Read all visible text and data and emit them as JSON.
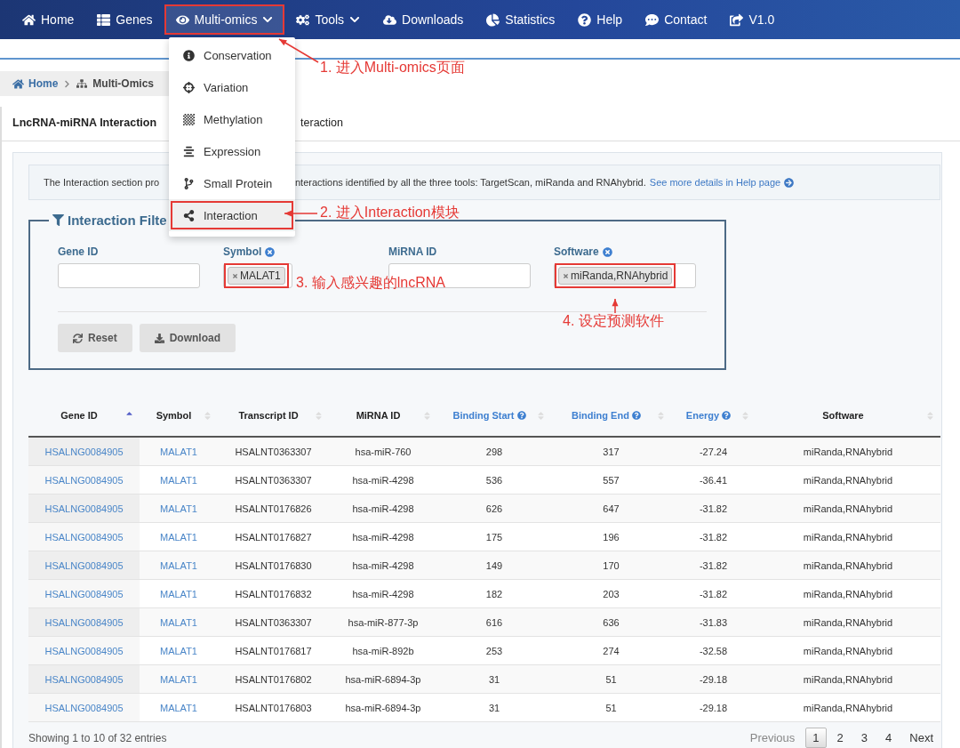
{
  "nav": {
    "items": [
      {
        "label": "Home",
        "selected": false,
        "caret": false,
        "marked": false
      },
      {
        "label": "Genes",
        "selected": false,
        "caret": false,
        "marked": false
      },
      {
        "label": "Multi-omics",
        "selected": true,
        "caret": true,
        "marked": true
      },
      {
        "label": "Tools",
        "selected": false,
        "caret": true,
        "marked": false
      },
      {
        "label": "Downloads",
        "selected": false,
        "caret": false,
        "marked": false
      },
      {
        "label": "Statistics",
        "selected": false,
        "caret": false,
        "marked": false
      },
      {
        "label": "Help",
        "selected": false,
        "caret": false,
        "marked": false
      },
      {
        "label": "Contact",
        "selected": false,
        "caret": false,
        "marked": false
      },
      {
        "label": "V1.0",
        "selected": false,
        "caret": false,
        "marked": false
      }
    ]
  },
  "dropdown": {
    "items": [
      {
        "label": "Conservation",
        "selected": false,
        "marked": false
      },
      {
        "label": "Variation",
        "selected": false,
        "marked": false
      },
      {
        "label": "Methylation",
        "selected": false,
        "marked": false
      },
      {
        "label": "Expression",
        "selected": false,
        "marked": false
      },
      {
        "label": "Small Protein",
        "selected": false,
        "marked": false
      },
      {
        "label": "Interaction",
        "selected": true,
        "marked": true
      }
    ]
  },
  "breadcrumb": [
    {
      "label": "Home"
    },
    {
      "label": "Multi-Omics"
    }
  ],
  "tabs": [
    {
      "label": "LncRNA-miRNA Interaction",
      "selected": true
    },
    {
      "label": "teraction",
      "selected": false
    }
  ],
  "description": {
    "before": "The Interaction section pro",
    "after": "nteractions identified by all the three tools: TargetScan, miRanda and RNAhybrid.",
    "link": "See more details in Help page"
  },
  "filter": {
    "legend": "Interaction Filte",
    "fields": [
      {
        "label": "Gene ID",
        "clearable": false
      },
      {
        "label": "Symbol",
        "clearable": true,
        "tag": {
          "text": "MALAT1",
          "marked": true
        }
      },
      {
        "label": "MiRNA ID",
        "clearable": false
      },
      {
        "label": "Software",
        "clearable": true,
        "tag": {
          "text": "miRanda,RNAhybrid",
          "marked": true
        }
      }
    ],
    "buttons": [
      "Reset",
      "Download"
    ]
  },
  "table": {
    "columns": [
      {
        "label": "Gene ID",
        "help": false,
        "sorted": true,
        "link": true
      },
      {
        "label": "Symbol",
        "help": false,
        "sorted": false,
        "link": true
      },
      {
        "label": "Transcript ID",
        "help": false,
        "sorted": false,
        "link": false
      },
      {
        "label": "MiRNA ID",
        "help": false,
        "sorted": false,
        "link": false
      },
      {
        "label": "Binding Start",
        "help": true,
        "sorted": false,
        "link": false
      },
      {
        "label": "Binding End",
        "help": true,
        "sorted": false,
        "link": false
      },
      {
        "label": "Energy",
        "help": true,
        "sorted": false,
        "link": false
      },
      {
        "label": "Software",
        "help": false,
        "sorted": false,
        "link": false
      }
    ],
    "rows": [
      [
        "HSALNG0084905",
        "MALAT1",
        "HSALNT0363307",
        "hsa-miR-760",
        "298",
        "317",
        "-27.24",
        "miRanda,RNAhybrid"
      ],
      [
        "HSALNG0084905",
        "MALAT1",
        "HSALNT0363307",
        "hsa-miR-4298",
        "536",
        "557",
        "-36.41",
        "miRanda,RNAhybrid"
      ],
      [
        "HSALNG0084905",
        "MALAT1",
        "HSALNT0176826",
        "hsa-miR-4298",
        "626",
        "647",
        "-31.82",
        "miRanda,RNAhybrid"
      ],
      [
        "HSALNG0084905",
        "MALAT1",
        "HSALNT0176827",
        "hsa-miR-4298",
        "175",
        "196",
        "-31.82",
        "miRanda,RNAhybrid"
      ],
      [
        "HSALNG0084905",
        "MALAT1",
        "HSALNT0176830",
        "hsa-miR-4298",
        "149",
        "170",
        "-31.82",
        "miRanda,RNAhybrid"
      ],
      [
        "HSALNG0084905",
        "MALAT1",
        "HSALNT0176832",
        "hsa-miR-4298",
        "182",
        "203",
        "-31.82",
        "miRanda,RNAhybrid"
      ],
      [
        "HSALNG0084905",
        "MALAT1",
        "HSALNT0363307",
        "hsa-miR-877-3p",
        "616",
        "636",
        "-31.83",
        "miRanda,RNAhybrid"
      ],
      [
        "HSALNG0084905",
        "MALAT1",
        "HSALNT0176817",
        "hsa-miR-892b",
        "253",
        "274",
        "-32.58",
        "miRanda,RNAhybrid"
      ],
      [
        "HSALNG0084905",
        "MALAT1",
        "HSALNT0176802",
        "hsa-miR-6894-3p",
        "31",
        "51",
        "-29.18",
        "miRanda,RNAhybrid"
      ],
      [
        "HSALNG0084905",
        "MALAT1",
        "HSALNT0176803",
        "hsa-miR-6894-3p",
        "31",
        "51",
        "-29.18",
        "miRanda,RNAhybrid"
      ]
    ]
  },
  "footer": {
    "info": "Showing 1 to 10 of 32 entries",
    "previous": "Previous",
    "pages": [
      {
        "label": "1",
        "selected": true
      },
      {
        "label": "2",
        "selected": false
      },
      {
        "label": "3",
        "selected": false
      },
      {
        "label": "4",
        "selected": false
      }
    ],
    "next": "Next"
  },
  "annotations": [
    {
      "text": "1. 进入Multi-omics页面"
    },
    {
      "text": "2. 进入Interaction模块"
    },
    {
      "text": "3. 输入感兴趣的lncRNA"
    },
    {
      "text": "4. 设定预测软件"
    }
  ]
}
